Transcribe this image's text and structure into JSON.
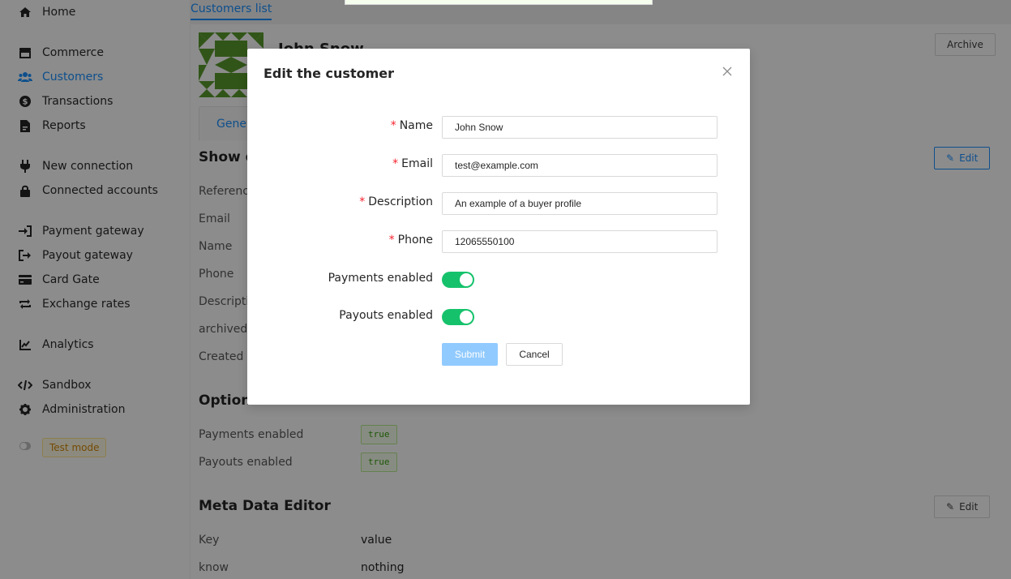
{
  "sidebar": {
    "items": [
      {
        "label": "Home",
        "icon": "home-icon"
      },
      {
        "label": "Commerce",
        "icon": "store-icon"
      },
      {
        "label": "Customers",
        "icon": "users-icon"
      },
      {
        "label": "Transactions",
        "icon": "dollar-icon"
      },
      {
        "label": "Reports",
        "icon": "file-report-icon"
      },
      {
        "label": "New connection",
        "icon": "plug-icon"
      },
      {
        "label": "Connected accounts",
        "icon": "lock-icon"
      },
      {
        "label": "Payment gateway",
        "icon": "sign-in-icon"
      },
      {
        "label": "Payout gateway",
        "icon": "sign-out-icon"
      },
      {
        "label": "Card Gate",
        "icon": "credit-card-icon"
      },
      {
        "label": "Exchange rates",
        "icon": "exchange-icon"
      },
      {
        "label": "Analytics",
        "icon": "chart-line-icon"
      },
      {
        "label": "Sandbox",
        "icon": "code-icon"
      },
      {
        "label": "Administration",
        "icon": "gear-icon"
      }
    ],
    "test_mode_label": "Test mode"
  },
  "main": {
    "breadcrumb": "Customers list",
    "customer_name": "John Snow",
    "archive_label": "Archive",
    "tab_general": "General",
    "show_details_title": "Show details",
    "edit_label": "Edit",
    "detail_labels": [
      "Reference",
      "Email",
      "Name",
      "Phone",
      "Description",
      "archived",
      "Created"
    ],
    "options_title": "Options",
    "options": [
      {
        "label": "Payments enabled",
        "value": "true"
      },
      {
        "label": "Payouts enabled",
        "value": "true"
      }
    ],
    "meta_title": "Meta Data Editor",
    "meta_edit_label": "Edit",
    "meta_rows": [
      {
        "key": "Key",
        "value": "value"
      },
      {
        "key": "know",
        "value": "nothing"
      }
    ]
  },
  "modal": {
    "title": "Edit the customer",
    "fields": {
      "name_label": "Name",
      "name_value": "John Snow",
      "email_label": "Email",
      "email_value": "test@example.com",
      "description_label": "Description",
      "description_value": "An example of a buyer profile",
      "phone_label": "Phone",
      "phone_value": "12065550100"
    },
    "payments_enabled_label": "Payments enabled",
    "payments_enabled": true,
    "payouts_enabled_label": "Payouts enabled",
    "payouts_enabled": true,
    "submit_label": "Submit",
    "cancel_label": "Cancel"
  },
  "colors": {
    "primary": "#1890ff",
    "switch_on": "#15c26b",
    "submit_disabled": "#91caff",
    "required": "#f5222d"
  }
}
